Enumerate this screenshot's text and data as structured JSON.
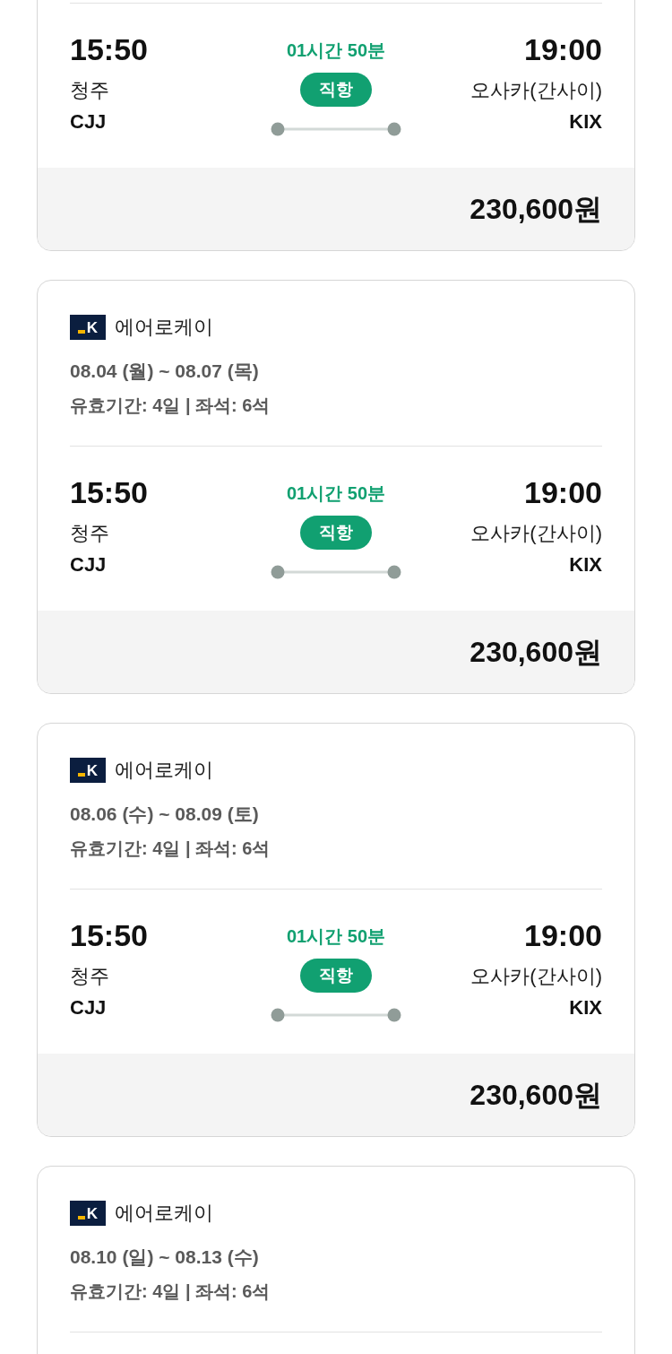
{
  "offers": [
    {
      "segment": {
        "depart_time": "15:50",
        "depart_city": "청주",
        "depart_code": "CJJ",
        "duration": "01시간 50분",
        "route_badge": "직항",
        "arrive_time": "19:00",
        "arrive_city": "오사카(간사이)",
        "arrive_code": "KIX"
      },
      "price": "230,600원"
    },
    {
      "airline": {
        "logo_mark": "K",
        "name": "에어로케이"
      },
      "dates": "08.04 (월) ~ 08.07 (목)",
      "validity": "유효기간: 4일 | 좌석: 6석",
      "segment": {
        "depart_time": "15:50",
        "depart_city": "청주",
        "depart_code": "CJJ",
        "duration": "01시간 50분",
        "route_badge": "직항",
        "arrive_time": "19:00",
        "arrive_city": "오사카(간사이)",
        "arrive_code": "KIX"
      },
      "price": "230,600원"
    },
    {
      "airline": {
        "logo_mark": "K",
        "name": "에어로케이"
      },
      "dates": "08.06 (수) ~ 08.09 (토)",
      "validity": "유효기간: 4일 | 좌석: 6석",
      "segment": {
        "depart_time": "15:50",
        "depart_city": "청주",
        "depart_code": "CJJ",
        "duration": "01시간 50분",
        "route_badge": "직항",
        "arrive_time": "19:00",
        "arrive_city": "오사카(간사이)",
        "arrive_code": "KIX"
      },
      "price": "230,600원"
    },
    {
      "airline": {
        "logo_mark": "K",
        "name": "에어로케이"
      },
      "dates": "08.10 (일) ~ 08.13 (수)",
      "validity": "유효기간: 4일 | 좌석: 6석"
    }
  ]
}
